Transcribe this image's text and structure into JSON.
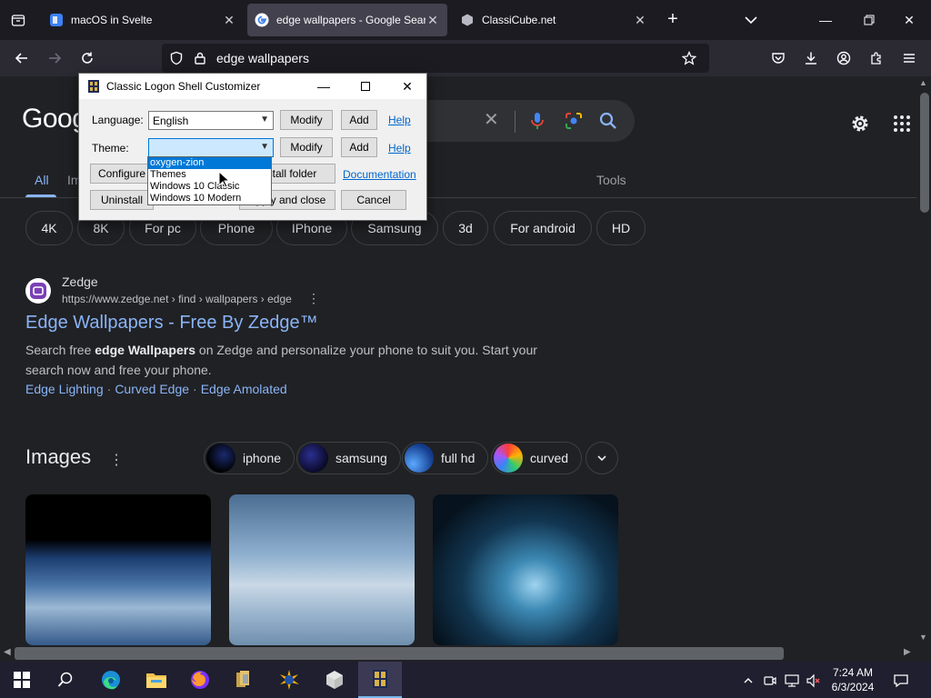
{
  "browser": {
    "tabs": [
      {
        "title": "macOS in Svelte",
        "icon": "svelte-page-icon",
        "active": false
      },
      {
        "title": "edge wallpapers - Google Search",
        "icon": "google-icon",
        "active": true
      },
      {
        "title": "ClassiCube.net",
        "icon": "classicube-icon",
        "active": false
      }
    ],
    "new_tab": "+",
    "url": "edge wallpapers"
  },
  "google": {
    "logo": "Goog",
    "search_tabs": [
      "All",
      "Im"
    ],
    "tools": "Tools",
    "chips": [
      "4K",
      "8K",
      "For pc",
      "Phone",
      "IPhone",
      "Samsung",
      "3d",
      "For android",
      "HD"
    ],
    "result": {
      "site": "Zedge",
      "url": "https://www.zedge.net › find › wallpapers › edge",
      "title": "Edge Wallpapers - Free By Zedge™",
      "snippet_pre": "Search free ",
      "snippet_bold": "edge Wallpapers",
      "snippet_post": " on Zedge and personalize your phone to suit you. Start your search now and free your phone.",
      "links": [
        "Edge Lighting",
        "Curved Edge",
        "Edge Amolated"
      ]
    },
    "images": {
      "heading": "Images",
      "chips": [
        "iphone",
        "samsung",
        "full hd",
        "curved"
      ]
    }
  },
  "dialog": {
    "title": "Classic Logon Shell Customizer",
    "language_label": "Language:",
    "language_value": "English",
    "theme_label": "Theme:",
    "theme_value": "",
    "modify": "Modify",
    "add": "Add",
    "help": "Help",
    "configure": "Configure",
    "install_folder": "Install folder",
    "documentation": "Documentation",
    "uninstall": "Uninstall",
    "apply_close": "Apply and close",
    "cancel": "Cancel",
    "theme_options": [
      "oxygen-zion",
      "Themes",
      "Windows 10 Classic",
      "Windows 10 Modern"
    ],
    "selected_option": "oxygen-zion"
  },
  "taskbar": {
    "time": "7:24 AM",
    "date": "6/3/2024"
  },
  "colors": {
    "link_blue": "#8ab4f8",
    "page_bg": "#202124",
    "taskbar_bg": "#1f1f30",
    "selection_blue": "#0078d7"
  }
}
